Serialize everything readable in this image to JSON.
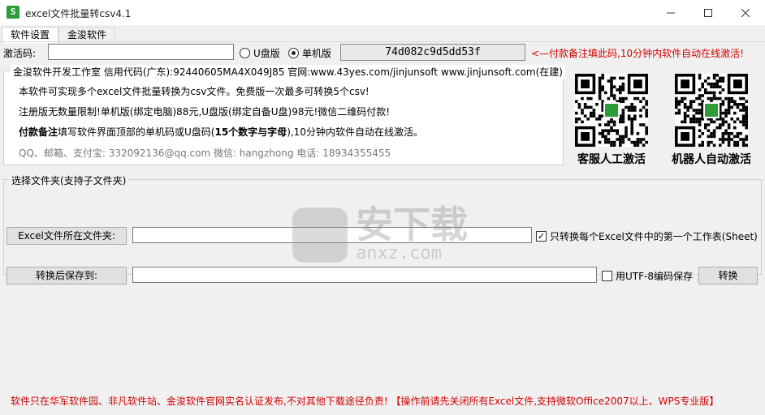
{
  "window": {
    "title": "excel文件批量转csv4.1",
    "icon_label": "S"
  },
  "tabs": [
    {
      "label": "软件设置"
    },
    {
      "label": "金浚软件"
    }
  ],
  "activation": {
    "label": "激活码:",
    "code_value": "",
    "radio_u": "U盘版",
    "radio_pc": "单机版",
    "selected": "单机版",
    "machine_code": "74d082c9d5dd53f",
    "hint": "<—付款备注填此码,10分钟内软件自动在线激活!"
  },
  "info": {
    "legend": "金浚软件开发工作室 信用代码(广东):92440605MA4X049J85 官网:www.43yes.com/jinjunsoft  www.jinjunsoft.com(在建)",
    "line1": "本软件可实现多个excel文件批量转换为csv文件。免费版一次最多可转换5个csv!",
    "line2": "注册版无数量限制!单机版(绑定电脑)88元,U盘版(绑定自备U盘)98元!微信二维码付款!",
    "line3_bold": "付款备注",
    "line3_rest": "填写软件界面顶部的单机码或U盘码(",
    "line3_bold2": "15个数字与字母",
    "line3_end": "),10分钟内软件自动在线激活。",
    "line4": "QQ、邮箱、支付宝: 332092136@qq.com   微信: hangzhong   电话: 18934355455"
  },
  "qr": [
    {
      "caption": "客服人工激活",
      "icon": "qr-code-icon"
    },
    {
      "caption": "机器人自动激活",
      "icon": "qr-code-icon"
    }
  ],
  "folder": {
    "legend": "选择文件夹(支持子文件夹)",
    "src_button": "Excel文件所在文件夹:",
    "src_value": "",
    "first_sheet_label": "只转换每个Excel文件中的第一个工作表(Sheet)",
    "first_sheet_checked": true,
    "dst_button": "转换后保存到:",
    "dst_value": "",
    "utf8_label": "用UTF-8编码保存",
    "utf8_checked": false,
    "convert_button": "转换"
  },
  "watermark": {
    "text": "安下载",
    "sub": "anxz.com"
  },
  "footer": "软件只在华军软件园、非凡软件站、金浚软件官网实名认证发布,不对其他下载途径负责! 【操作前请先关闭所有Excel文件,支持微软Office2007以上、WPS专业版】",
  "colors": {
    "red": "#d00000",
    "background": "#f0f0f0",
    "icon_green": "#2e9c3a"
  }
}
